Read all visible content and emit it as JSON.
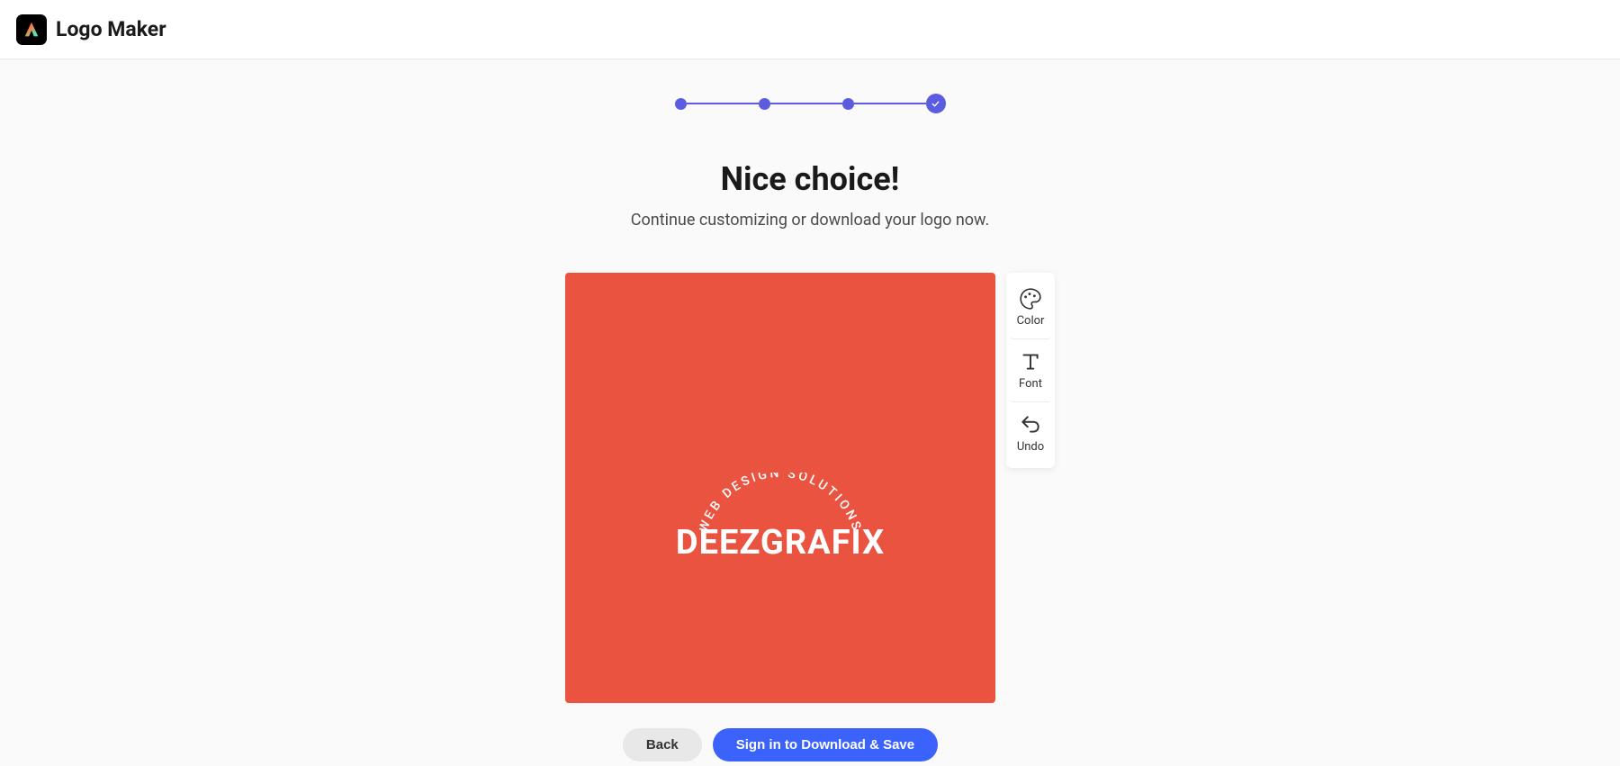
{
  "header": {
    "app_title": "Logo Maker"
  },
  "progress": {
    "steps": 4,
    "current": 4
  },
  "main": {
    "heading": "Nice choice!",
    "subheading": "Continue customizing or download your logo now."
  },
  "canvas": {
    "background_color": "#ea5340",
    "arc_text": "WEB DESIGN SOLUTIONS",
    "main_text": "DEEZGRAFIX"
  },
  "toolbar": {
    "color_label": "Color",
    "font_label": "Font",
    "undo_label": "Undo"
  },
  "buttons": {
    "back": "Back",
    "download": "Sign in to Download & Save"
  },
  "colors": {
    "accent": "#5c5ce0",
    "primary_button": "#3b63fb"
  }
}
